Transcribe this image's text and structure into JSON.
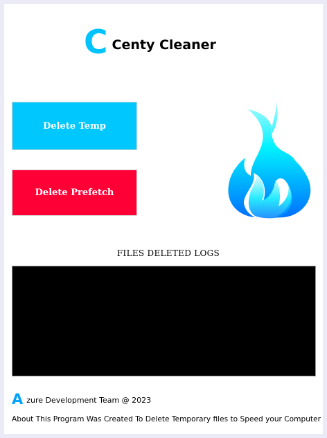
{
  "app": {
    "logo_letter": "C",
    "title": "Centy Cleaner"
  },
  "buttons": {
    "delete_temp": "Delete Temp",
    "delete_prefetch": "Delete Prefetch"
  },
  "logs": {
    "label": "FILES DELETED LOGS"
  },
  "footer": {
    "team_letter": "A",
    "team_text": "zure Development Team @ 2023",
    "about": "About This Program Was Created To Delete Temporary files to Speed your Computer"
  },
  "colors": {
    "accent": "#00c8ff",
    "danger": "#ff0036",
    "logs_background": "#000000",
    "flame_light": "#dcfbff",
    "flame_mid": "#00f2ff",
    "flame_dark": "#0070ff"
  },
  "icons": {
    "flame": "flame-icon"
  }
}
